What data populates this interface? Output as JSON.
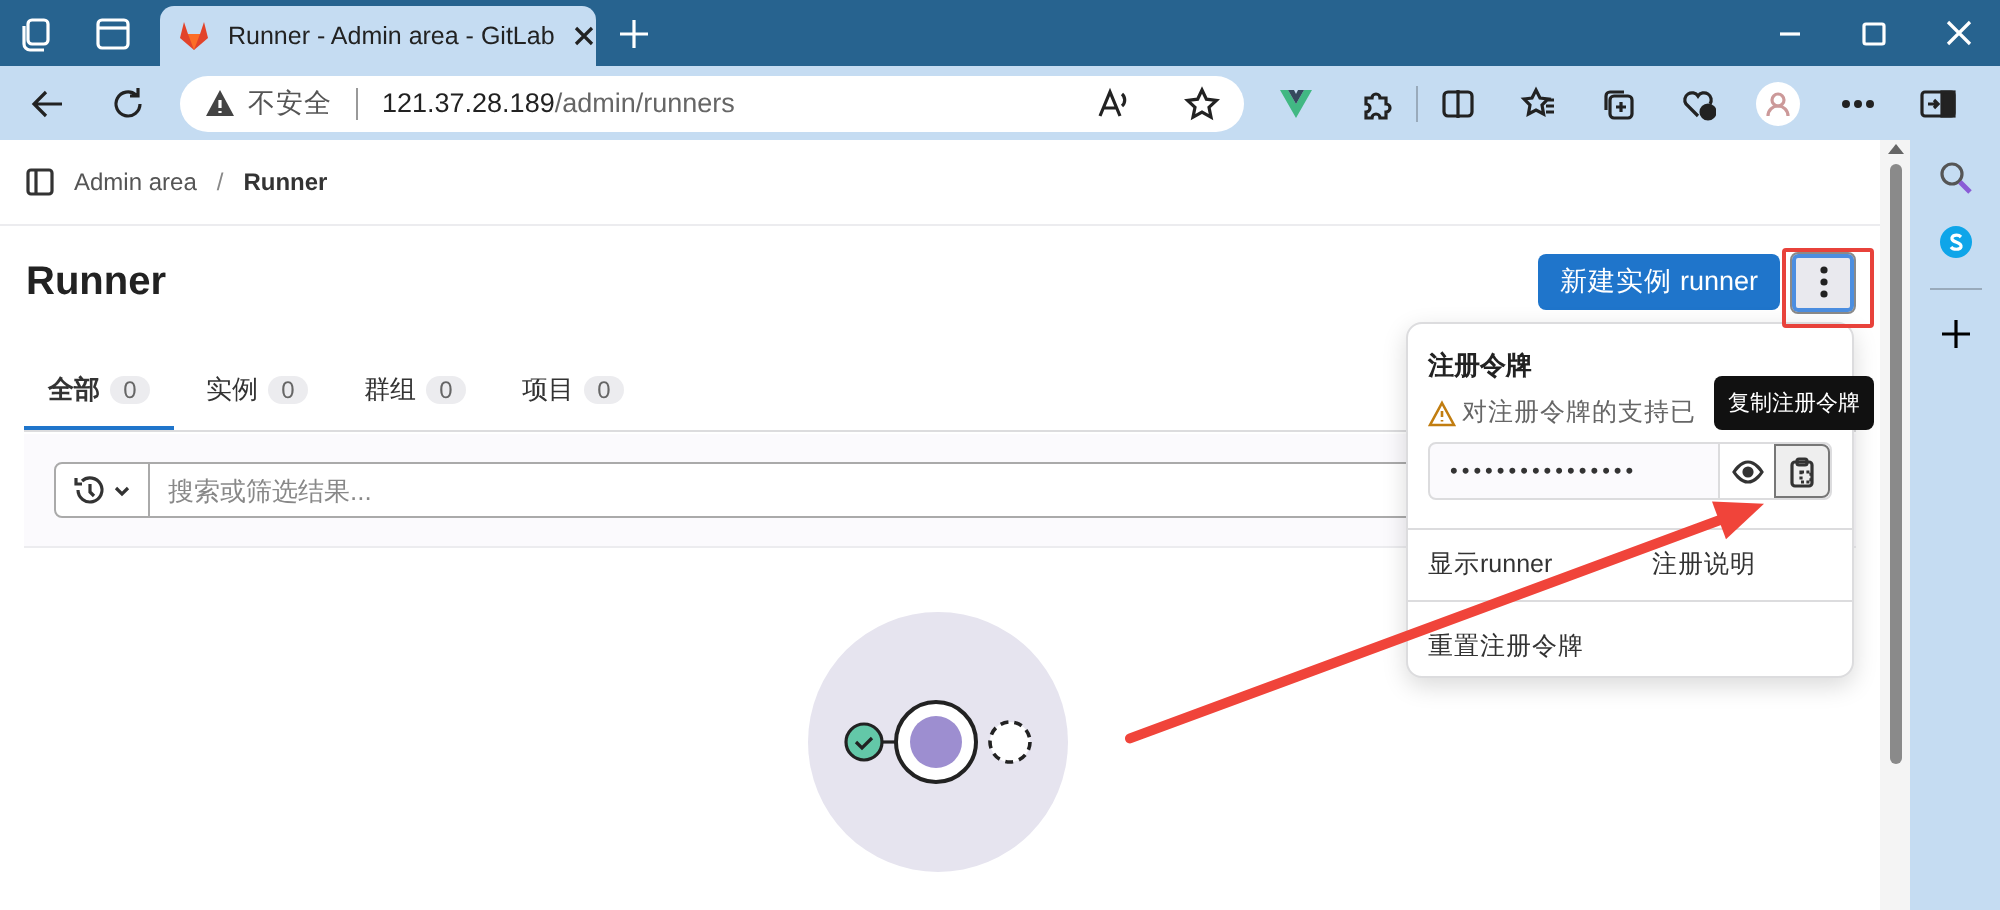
{
  "browser": {
    "tab_title": "Runner - Admin area - GitLab",
    "security_label": "不安全",
    "url_host": "121.37.28.189",
    "url_path": "/admin/runners"
  },
  "breadcrumb": {
    "separator": "/",
    "items": [
      {
        "label": "Admin area",
        "current": false
      },
      {
        "label": "Runner",
        "current": true
      }
    ]
  },
  "page_title": "Runner",
  "new_runner_button": "新建实例 runner",
  "more_menu": {
    "expanded": true
  },
  "tabs": [
    {
      "label": "全部",
      "count": "0",
      "selected": true
    },
    {
      "label": "实例",
      "count": "0",
      "selected": false
    },
    {
      "label": "群组",
      "count": "0",
      "selected": false
    },
    {
      "label": "项目",
      "count": "0",
      "selected": false
    }
  ],
  "search": {
    "placeholder": "搜索或筛选结果..."
  },
  "dropdown": {
    "heading": "注册令牌",
    "warning": "对注册令牌的支持已",
    "token": "••••••••••••••••",
    "tooltip": "复制注册令牌",
    "items": [
      {
        "segments": [
          "显示runner",
          "注册说明"
        ]
      },
      {
        "segments": [
          "重置注册令牌"
        ]
      }
    ]
  }
}
